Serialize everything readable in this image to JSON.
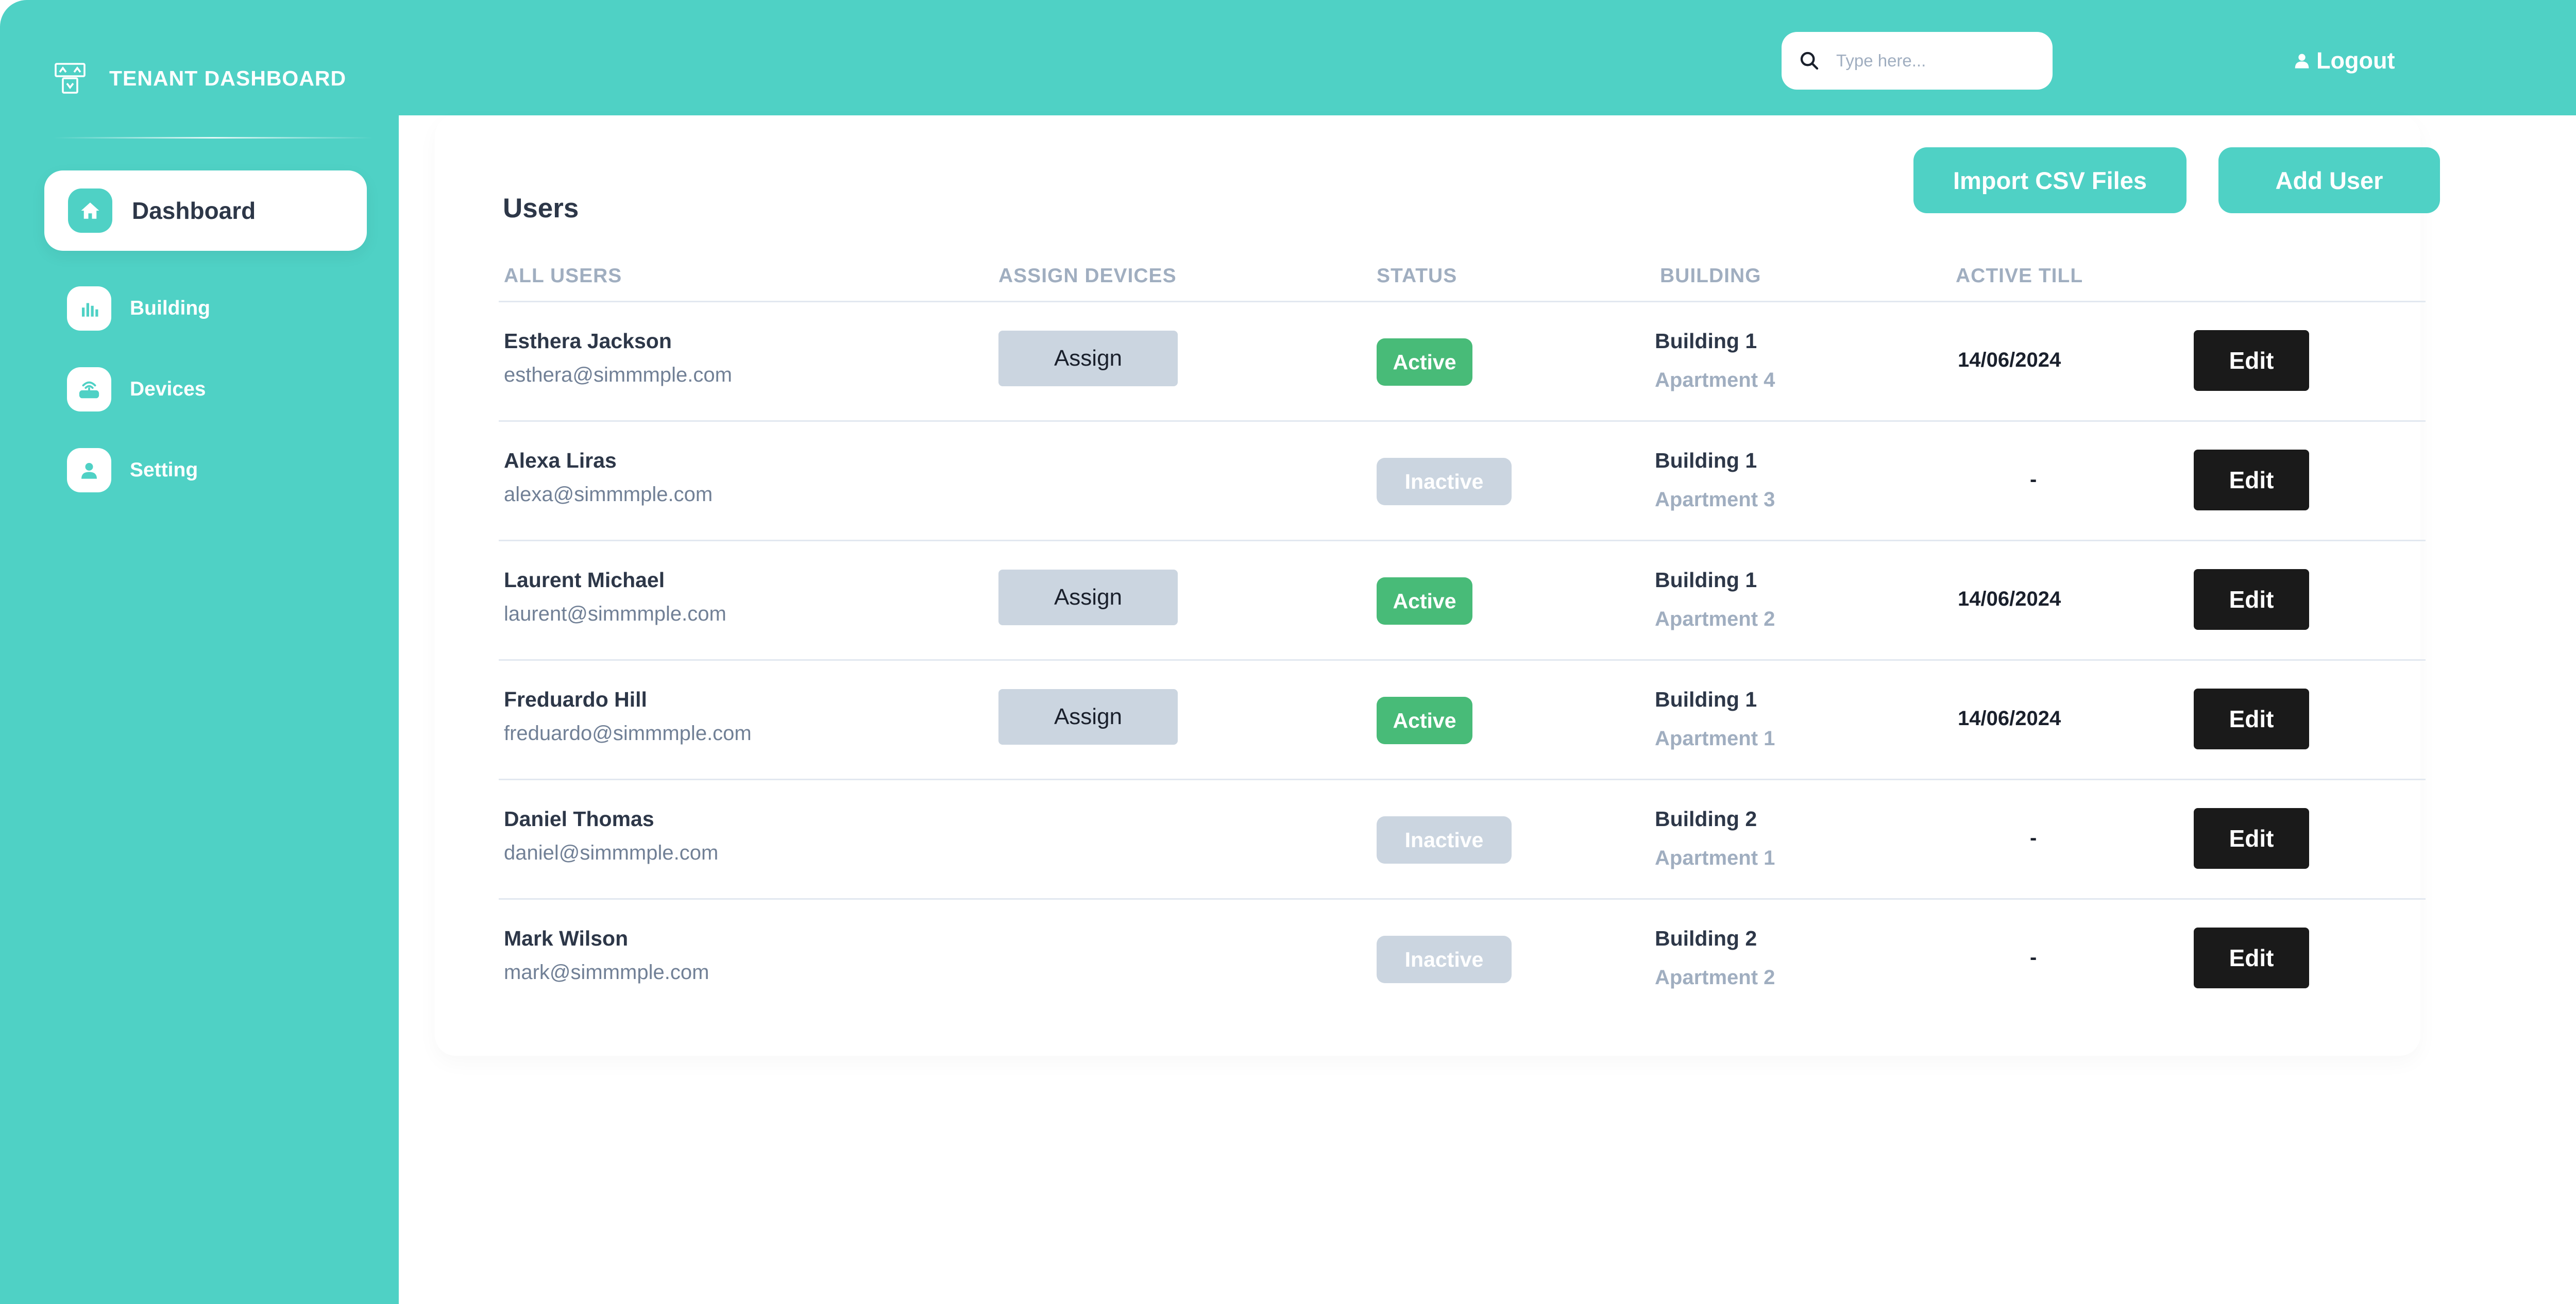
{
  "brand": {
    "title": "TENANT DASHBOARD",
    "icon": "tenant-logo-icon"
  },
  "sidebar": {
    "items": [
      {
        "label": "Dashboard",
        "icon": "home-icon",
        "active": true
      },
      {
        "label": "Building",
        "icon": "bar-chart-icon",
        "active": false
      },
      {
        "label": "Devices",
        "icon": "router-icon",
        "active": false
      },
      {
        "label": "Setting",
        "icon": "person-icon",
        "active": false
      }
    ]
  },
  "header": {
    "search_placeholder": "Type here...",
    "logout_label": "Logout"
  },
  "main": {
    "title": "Users",
    "import_label": "Import CSV Files",
    "add_label": "Add User",
    "columns": [
      "ALL USERS",
      "ASSIGN DEVICES",
      "STATUS",
      "BUILDING",
      "ACTIVE TILL"
    ],
    "rows": [
      {
        "name": "Esthera Jackson",
        "email": "esthera@simmmple.com",
        "assign": "Assign",
        "status": "Active",
        "building": "Building 1",
        "apartment": "Apartment 4",
        "active_till": "14/06/2024",
        "edit": "Edit"
      },
      {
        "name": "Alexa Liras",
        "email": "alexa@simmmple.com",
        "assign": "",
        "status": "Inactive",
        "building": "Building 1",
        "apartment": "Apartment 3",
        "active_till": "-",
        "edit": "Edit"
      },
      {
        "name": "Laurent Michael",
        "email": "laurent@simmmple.com",
        "assign": "Assign",
        "status": "Active",
        "building": "Building 1",
        "apartment": "Apartment 2",
        "active_till": "14/06/2024",
        "edit": "Edit"
      },
      {
        "name": "Freduardo Hill",
        "email": "freduardo@simmmple.com",
        "assign": "Assign",
        "status": "Active",
        "building": "Building 1",
        "apartment": "Apartment 1",
        "active_till": "14/06/2024",
        "edit": "Edit"
      },
      {
        "name": "Daniel Thomas",
        "email": "daniel@simmmple.com",
        "assign": "",
        "status": "Inactive",
        "building": "Building 2",
        "apartment": "Apartment 1",
        "active_till": "-",
        "edit": "Edit"
      },
      {
        "name": "Mark Wilson",
        "email": "mark@simmmple.com",
        "assign": "",
        "status": "Inactive",
        "building": "Building 2",
        "apartment": "Apartment 2",
        "active_till": "-",
        "edit": "Edit"
      }
    ]
  },
  "colors": {
    "accent": "#4fd1c5",
    "active": "#48bb78",
    "inactive": "#cbd5e0",
    "edit": "#1a1a1a"
  }
}
